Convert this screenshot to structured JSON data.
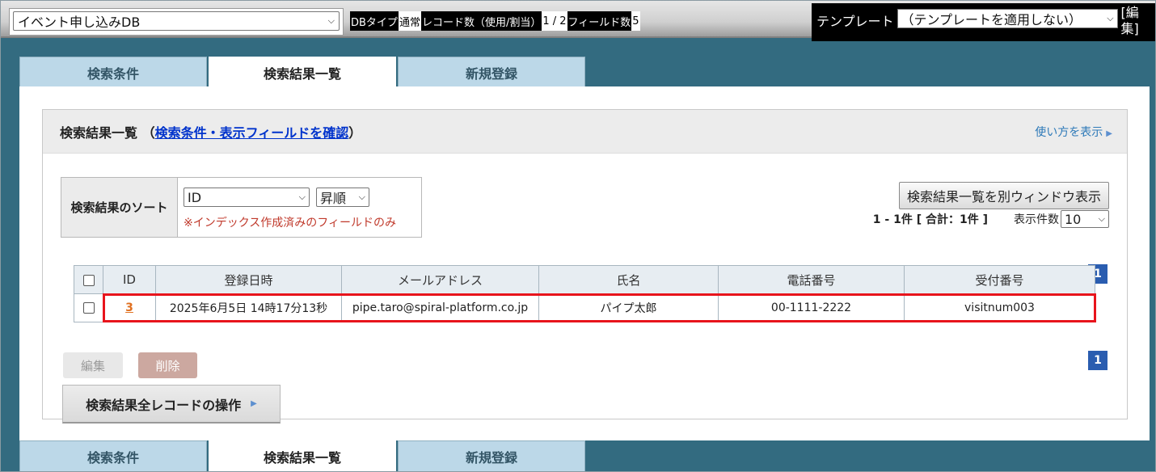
{
  "topbar": {
    "db_name": "イベント申し込みDB",
    "meta": {
      "db_type_label": "DBタイプ",
      "db_type_value": "通常",
      "records_label": "レコード数（使用/割当）",
      "records_value": "1 / 2",
      "fields_label": "フィールド数",
      "fields_value": "5"
    },
    "template_label": "テンプレート",
    "template_value": "（テンプレートを適用しない）",
    "template_edit": "[編集]"
  },
  "tabs": [
    {
      "label": "検索条件"
    },
    {
      "label": "検索結果一覧"
    },
    {
      "label": "新規登録"
    }
  ],
  "panel": {
    "title_prefix": "検索結果一覧 （",
    "title_link": "検索条件・表示フィールドを確認",
    "title_suffix": "）",
    "help": "使い方を表示",
    "sort": {
      "label": "検索結果のソート",
      "field": "ID",
      "order": "昇順",
      "note": "※インデックス作成済みのフィールドのみ"
    },
    "popup_button": "検索結果一覧を別ウィンドウ表示",
    "count_text": "1 - 1件 [ 合計：1件 ]",
    "per_page_label": "表示件数",
    "per_page": "10",
    "page_number": "1",
    "table": {
      "headers": [
        "ID",
        "登録日時",
        "メールアドレス",
        "氏名",
        "電話番号",
        "受付番号"
      ],
      "rows": [
        {
          "id": "3",
          "registered": "2025年6月5日 14時17分13秒",
          "email": "pipe.taro@spiral-platform.co.jp",
          "name": "パイプ太郎",
          "phone": "00-1111-2222",
          "receipt": "visitnum003"
        }
      ]
    },
    "edit_button": "編集",
    "delete_button": "削除",
    "all_ops_button": "検索結果全レコードの操作"
  }
}
